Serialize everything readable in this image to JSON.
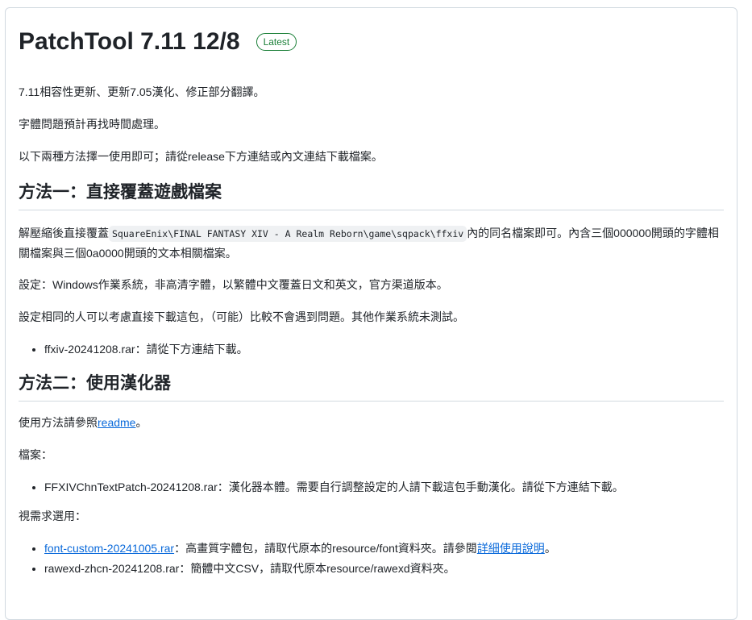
{
  "release": {
    "title": "PatchTool 7.11 12/8",
    "badge": "Latest"
  },
  "intro": [
    "7.11相容性更新、更新7.05漢化、修正部分翻譯。",
    "字體問題預計再找時間處理。",
    "以下兩種方法擇一使用即可；請從release下方連結或內文連結下載檔案。"
  ],
  "method1": {
    "heading": "方法一：直接覆蓋遊戲檔案",
    "p1_before": "解壓縮後直接覆蓋",
    "p1_code": "SquareEnix\\FINAL FANTASY XIV - A Realm Reborn\\game\\sqpack\\ffxiv",
    "p1_after": "內的同名檔案即可。內含三個000000開頭的字體相關檔案與三個0a0000開頭的文本相關檔案。",
    "p2": "設定：Windows作業系統，非高清字體，以繁體中文覆蓋日文和英文，官方渠道版本。",
    "p3": "設定相同的人可以考慮直接下載這包，（可能）比較不會遇到問題。其他作業系統未測試。",
    "items": [
      {
        "name": "ffxiv-20241208.rar",
        "desc": "：請從下方連結下載。"
      }
    ]
  },
  "method2": {
    "heading": "方法二：使用漢化器",
    "p1_before": "使用方法請參照",
    "p1_link": "readme",
    "p1_after": "。",
    "files_label": "檔案：",
    "items": [
      {
        "name": "FFXIVChnTextPatch-20241208.rar",
        "desc": "：漢化器本體。需要自行調整設定的人請下載這包手動漢化。請從下方連結下載。"
      }
    ],
    "optional_label": "視需求選用：",
    "optional": [
      {
        "name": "font-custom-20241005.rar",
        "desc": "：高畫質字體包，請取代原本的resource/font資料夾。請參閱",
        "link": "詳細使用說明",
        "end": "。"
      },
      {
        "name": "rawexd-zhcn-20241208.rar",
        "desc": "：簡體中文CSV，請取代原本resource/rawexd資料夾。"
      }
    ]
  }
}
